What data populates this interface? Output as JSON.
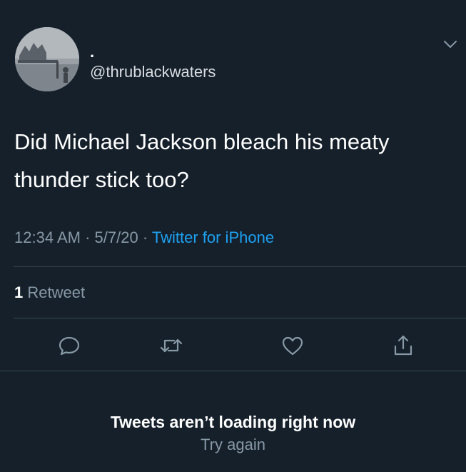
{
  "tweet": {
    "display_name": ".",
    "handle": "@thrublackwaters",
    "text": "Did Michael Jackson bleach his meaty thunder stick too?",
    "time": "12:34 AM",
    "date": "5/7/20",
    "source": "Twitter for iPhone",
    "retweet_count": "1",
    "retweet_label": "Retweet"
  },
  "icons": {
    "more": "chevron-down-icon",
    "reply": "reply-icon",
    "retweet": "retweet-icon",
    "like": "heart-icon",
    "share": "share-icon"
  },
  "status": {
    "message": "Tweets aren’t loading right now",
    "retry": "Try again"
  },
  "colors": {
    "background": "#15202b",
    "primary_text": "#ffffff",
    "secondary_text": "#8899a6",
    "link": "#1da1f2",
    "divider": "#38444d"
  }
}
